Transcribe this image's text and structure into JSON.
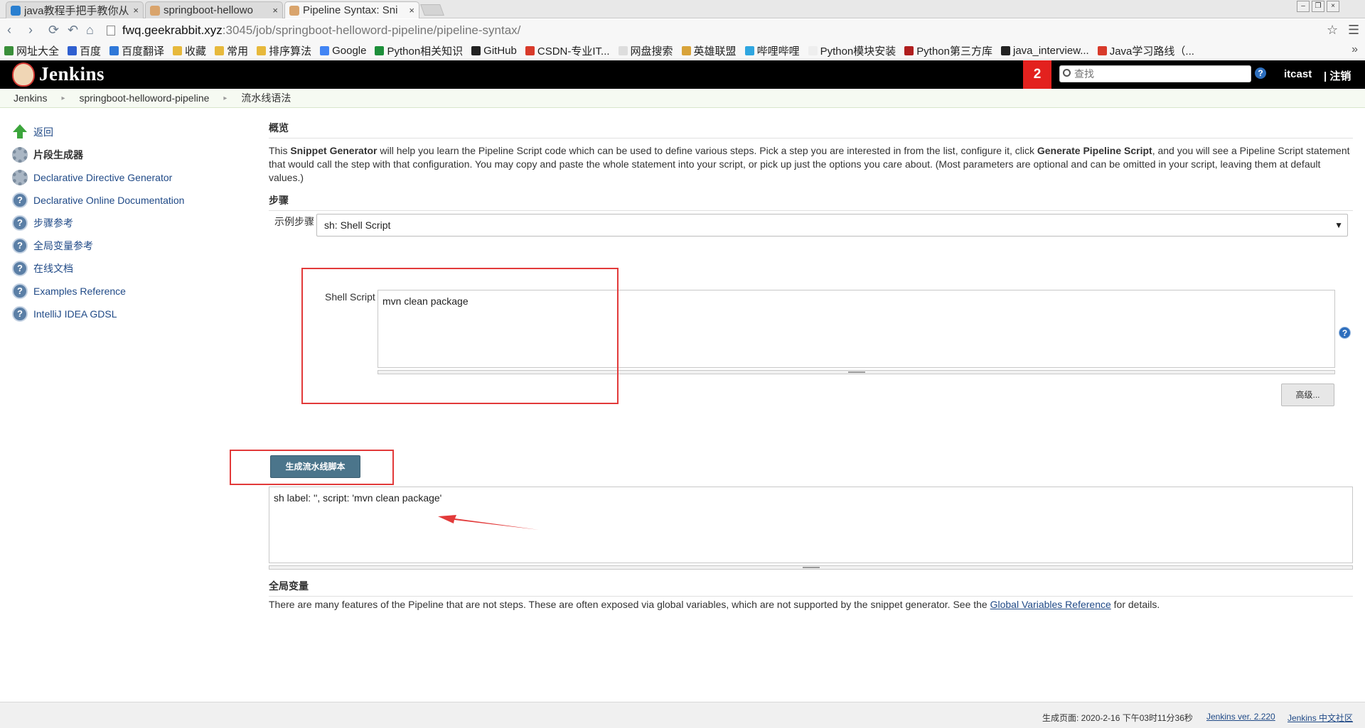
{
  "browser": {
    "tabs": [
      {
        "title": "java教程手把手教你从",
        "favicon_color": "#2a7fd0"
      },
      {
        "title": "springboot-hellowo",
        "favicon_color": "#d9a46c"
      },
      {
        "title": "Pipeline Syntax: Sni",
        "favicon_color": "#d9a46c"
      }
    ],
    "tab_close": "×",
    "url_host": "fwq.geekrabbit.xyz",
    "url_path": ":3045/job/springboot-helloword-pipeline/pipeline-syntax/",
    "nav": {
      "back": "‹",
      "forward": "›",
      "reload": "⟳",
      "undo": "↶",
      "home": "⌂",
      "star": "☆",
      "menu": "☰"
    },
    "bookmarks": [
      {
        "label": "网址大全",
        "icon": "bookmark-grid-icon",
        "color": "#3a8f3a"
      },
      {
        "label": "百度",
        "icon": "baidu-paw-icon",
        "color": "#2f5fd0"
      },
      {
        "label": "百度翻译",
        "icon": "translate-icon",
        "color": "#2f78d8"
      },
      {
        "label": "收藏",
        "icon": "folder-icon",
        "color": "#e7b93c"
      },
      {
        "label": "常用",
        "icon": "folder-icon",
        "color": "#e7b93c"
      },
      {
        "label": "排序算法",
        "icon": "folder-icon",
        "color": "#e7b93c"
      },
      {
        "label": "Google",
        "icon": "google-icon",
        "color": "#4285f4"
      },
      {
        "label": "Python相关知识",
        "icon": "pycharm-icon",
        "color": "#1d8f3a"
      },
      {
        "label": "GitHub",
        "icon": "github-icon",
        "color": "#222222"
      },
      {
        "label": "CSDN-专业IT...",
        "icon": "csdn-icon",
        "color": "#d83a2a"
      },
      {
        "label": "网盘搜索",
        "icon": "page-icon",
        "color": "#dddddd"
      },
      {
        "label": "英雄联盟",
        "icon": "game-icon",
        "color": "#d8a33a"
      },
      {
        "label": "哔哩哔哩",
        "icon": "bilibili-icon",
        "color": "#2fa6e0"
      },
      {
        "label": "Python模块安装",
        "icon": "page-icon",
        "color": "#eeeeee"
      },
      {
        "label": "Python第三方库",
        "icon": "python-icon",
        "color": "#b01e1e"
      },
      {
        "label": "java_interview...",
        "icon": "github-icon",
        "color": "#222222"
      },
      {
        "label": "Java学习路线（...",
        "icon": "csdn-icon",
        "color": "#d83a2a"
      }
    ],
    "bookmarks_more": "»"
  },
  "jenkins": {
    "logo_text": "Jenkins",
    "notification_count": "2",
    "search_placeholder": "查找",
    "help": "?",
    "user": "itcast",
    "logout": "| 注销"
  },
  "breadcrumb": {
    "sep": "▸",
    "items": [
      "Jenkins",
      "springboot-helloword-pipeline",
      "流水线语法"
    ]
  },
  "sidebar": {
    "items": [
      {
        "label": "返回",
        "icon": "up-arrow-icon"
      },
      {
        "label": "片段生成器",
        "icon": "gear-icon"
      },
      {
        "label": "Declarative Directive Generator",
        "icon": "gear-icon"
      },
      {
        "label": "Declarative Online Documentation",
        "icon": "help-icon"
      },
      {
        "label": "步骤参考",
        "icon": "help-icon"
      },
      {
        "label": "全局变量参考",
        "icon": "help-icon"
      },
      {
        "label": "在线文档",
        "icon": "help-icon"
      },
      {
        "label": "Examples Reference",
        "icon": "help-icon"
      },
      {
        "label": "IntelliJ IDEA GDSL",
        "icon": "help-icon"
      }
    ],
    "qmark": "?"
  },
  "main": {
    "overview_title": "概览",
    "desc": {
      "p1": "This ",
      "b1": "Snippet Generator",
      "p2": " will help you learn the Pipeline Script code which can be used to define various steps. Pick a step you are interested in from the list, configure it, click ",
      "b2": "Generate Pipeline Script",
      "p3": ", and you will see a Pipeline Script statement that would call the step with that configuration. You may copy and paste the whole statement into your script, or pick up just the options you care about. (Most parameters are optional and can be omitted in your script, leaving them at default values.)"
    },
    "steps_title": "步骤",
    "sample_step_label": "示例步骤",
    "sample_step_value": "sh: Shell Script",
    "select_arrow": "▼",
    "shell_script_label": "Shell Script",
    "shell_script_value": "mvn clean package",
    "shell_help": "?",
    "advanced_button": "高级...",
    "generate_button": "生成流水线脚本",
    "generated_output": "sh label: '', script: 'mvn clean package'",
    "globals_title": "全局变量",
    "globals_desc_before": "There are many features of the Pipeline that are not steps. These are often exposed via global variables, which are not supported by the snippet generator. See the ",
    "globals_link": "Global Variables Reference",
    "globals_desc_after": " for details."
  },
  "footer": {
    "generated": "生成页面: 2020-2-16 下午03时11分36秒",
    "version": "Jenkins ver. 2.220",
    "community": "Jenkins 中文社区"
  },
  "annotation_color": "#e23a3a"
}
